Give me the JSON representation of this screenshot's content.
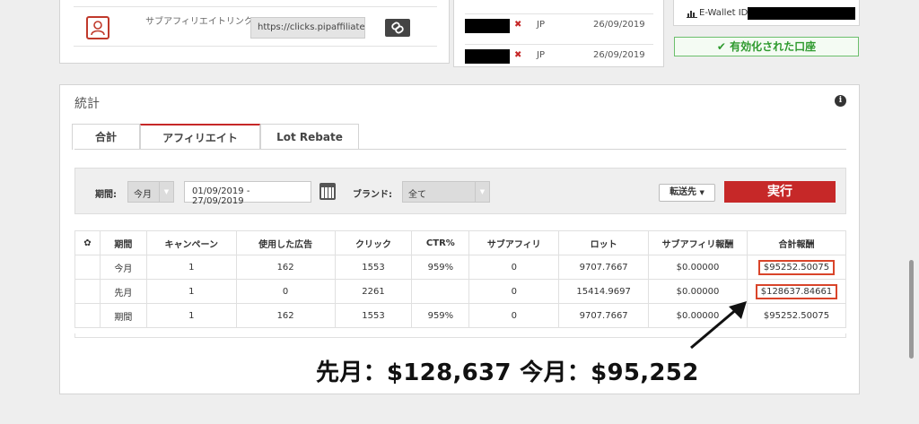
{
  "affiliate": {
    "sublink_label": "サブアフィリエイトリンク",
    "sublink_url": "https://clicks.pipaffiliates.com",
    "icons": {
      "sublink": "person-badge-icon",
      "copy": "chain-link-icon"
    }
  },
  "accounts": [
    {
      "country": "JP",
      "date": "26/09/2019"
    },
    {
      "country": "JP",
      "date": "26/09/2019"
    }
  ],
  "wallet": {
    "label": "E-Wallet ID",
    "status_badge": "有効化された口座"
  },
  "stats": {
    "title": "統計",
    "tabs": [
      "合計",
      "アフィリエイト",
      "Lot Rebate"
    ],
    "active_tab": "アフィリエイト",
    "filters": {
      "period_label": "期間:",
      "period_value": "今月",
      "date_range": "01/09/2019 - 27/09/2019",
      "brand_label": "ブランド:",
      "brand_value": "全て",
      "transfer_label": "転送先",
      "run_label": "実行"
    },
    "table": {
      "headers": [
        "期間",
        "キャンペーン",
        "使用した広告",
        "クリック",
        "CTR%",
        "サブアフィリ",
        "ロット",
        "サブアフィリ報酬",
        "合計報酬"
      ],
      "rows": [
        [
          "今月",
          "1",
          "162",
          "1553",
          "959%",
          "0",
          "9707.7667",
          "$0.00000",
          "$95252.50075"
        ],
        [
          "先月",
          "1",
          "0",
          "2261",
          "",
          "0",
          "15414.9697",
          "$0.00000",
          "$128637.84661"
        ],
        [
          "期間",
          "1",
          "162",
          "1553",
          "959%",
          "0",
          "9707.7667",
          "$0.00000",
          "$95252.50075"
        ]
      ],
      "highlighted_rows": [
        0,
        1
      ]
    }
  },
  "annotation": {
    "text": "先月：$128,637  今月：$95,252",
    "color": "#111111"
  },
  "colors": {
    "accent": "#c62828",
    "success": "#2e9a2e",
    "highlight_box": "#d9442a"
  }
}
